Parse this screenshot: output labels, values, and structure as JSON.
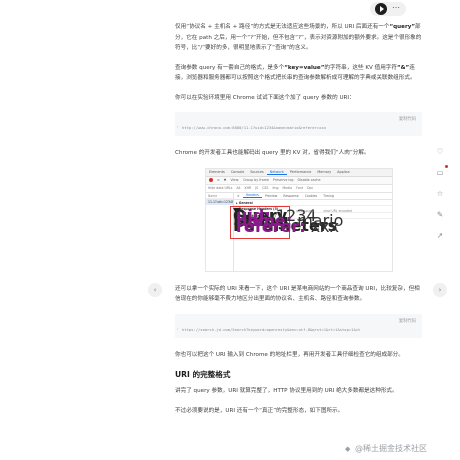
{
  "article": {
    "p1": "仅用“协议名 + 主机名 + 路径”的方式是无法适应这些场景的，所以 URI 后面还有一个",
    "p1_bold": "“query”",
    "p1_rest": "部分，它在 path 之后，用一个“?”开始，但不包含“?”，表示对资源附加的额外要求。这是个很形象的符号，比“/”要好的多，很明显地表示了“查询”的含义。",
    "p2_a": "查询参数 query 有一套自己的格式，是多个",
    "p2_bold": "“key=value”",
    "p2_b": "的字符串，这些 KV 值用字符",
    "p2_bold2": "“&”",
    "p2_c": "连接，浏览器和服务器都可以按照这个格式把长串的查询参数解析成可理解的字典或关联数组形式。",
    "p3": "你可以在实验环境里用 Chrome 试试下面这个加了 query 参数的 URI：",
    "code1": "http://www.chrono.com:8080/11-1?uid=1234&name=mario&referer=xxx",
    "copy_label": "复制代码",
    "p4": "Chrome 的开发者工具也能解码出 query 里的 KV 对，省得我们“人肉”分解。",
    "p5": "还可以拿一个实际的 URI 来看一下，这个 URI 是某电商网站的一个商品查询 URI，比较复杂，但相信现在的你能够毫不费力地区分出里面的协议名、主机名、路径和查询参数。",
    "code2": "https://search.jd.com/Search?keyword=openresty&enc=utf-8&qrst=1&rt=1&stop=1&vt",
    "p6": "你也可以把这个 URI 输入到 Chrome 的地址栏里，再用开发者工具仔细检查它的组成部分。",
    "h2": "URI 的完整格式",
    "p7": "讲完了 query 参数，URI 就算完整了，HTTP 协议里用到的 URI 绝大多数都是这种形式。",
    "p8": "不过必须要说的是，URI 还有一个“真正”的完整形态，如下图所示。"
  },
  "devtools": {
    "tabs": [
      "Elements",
      "Console",
      "Sources",
      "Network",
      "Performance",
      "Memory",
      "Applica"
    ],
    "active_tab": "Network",
    "tools": [
      "View:",
      "Group by frame",
      "Preserve log",
      "Disable cache"
    ],
    "filter": [
      "Hide data URLs",
      "All",
      "XHR",
      "JS",
      "CSS",
      "Img",
      "Media",
      "Font",
      "Doc"
    ],
    "req_head": "Name",
    "request": "11-1?uid=1234&name=...",
    "subtabs": [
      "Headers",
      "Preview",
      "Response",
      "Cookies",
      "Timing"
    ],
    "active_subtab": "Headers",
    "sections": [
      "▸ General",
      "▸ Response Headers (5)",
      "▸ Request Headers (8)"
    ],
    "query_title": "▾ Query String Parameters",
    "params": [
      {
        "k": "uid:",
        "v": "1234"
      },
      {
        "k": "name:",
        "v": "mario"
      },
      {
        "k": "referer:",
        "v": "xxx"
      }
    ],
    "view_links": [
      "view source",
      "view URL encoded"
    ]
  },
  "sidebar": {
    "icons": [
      "heart-icon",
      "comment-icon",
      "star-icon",
      "note-icon",
      "share-icon"
    ]
  },
  "watermark": "@稀土掘金技术社区"
}
